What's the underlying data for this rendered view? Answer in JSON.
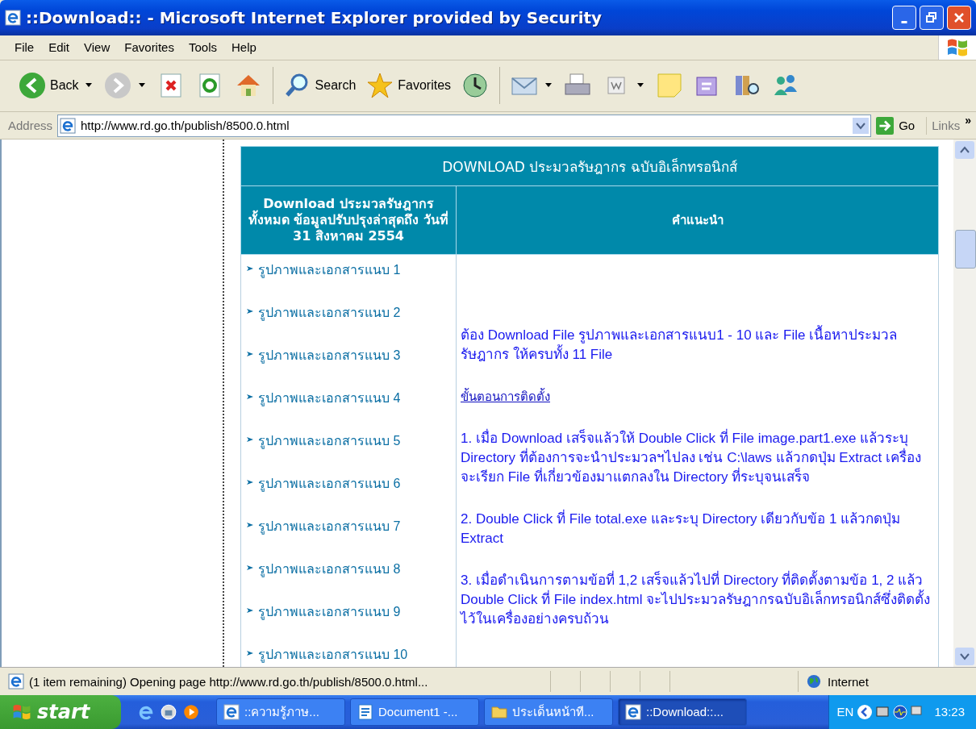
{
  "window": {
    "title": "::Download:: - Microsoft Internet Explorer provided by Security"
  },
  "menu": [
    "File",
    "Edit",
    "View",
    "Favorites",
    "Tools",
    "Help"
  ],
  "toolbar": [
    {
      "kind": "back",
      "label": "Back"
    },
    {
      "kind": "forward"
    },
    {
      "kind": "stop"
    },
    {
      "kind": "refresh"
    },
    {
      "kind": "home"
    },
    {
      "kind": "search",
      "label": "Search"
    },
    {
      "kind": "favorites",
      "label": "Favorites"
    },
    {
      "kind": "history"
    },
    {
      "kind": "mail"
    },
    {
      "kind": "print"
    },
    {
      "kind": "edit"
    },
    {
      "kind": "note"
    },
    {
      "kind": "messenger"
    },
    {
      "kind": "research"
    },
    {
      "kind": "people"
    }
  ],
  "address": {
    "label": "Address",
    "url": "http://www.rd.go.th/publish/8500.0.html",
    "go": "Go",
    "links": "Links",
    "more": "»"
  },
  "table": {
    "title": "DOWNLOAD ประมวลรัษฎากร ฉบับอิเล็กทรอนิกส์",
    "columns": [
      "Download ประมวลรัษฎากร ทั้งหมด ข้อมูลปรับปรุงล่าสุดถึง วันที่ 31 สิงหาคม 2554",
      "คำแนะนำ"
    ],
    "downloads": [
      "รูปภาพและเอกสารแนบ 1",
      "รูปภาพและเอกสารแนบ 2",
      "รูปภาพและเอกสารแนบ 3",
      "รูปภาพและเอกสารแนบ 4",
      "รูปภาพและเอกสารแนบ 5",
      "รูปภาพและเอกสารแนบ 6",
      "รูปภาพและเอกสารแนบ 7",
      "รูปภาพและเอกสารแนบ 8",
      "รูปภาพและเอกสารแนบ 9",
      "รูปภาพและเอกสารแนบ 10"
    ],
    "instructions": [
      {
        "kind": "paragraph",
        "text": "ต้อง Download File รูปภาพและเอกสารแนบ1 - 10 และ File เนื้อหาประมวลรัษฎากร ให้ครบทั้ง 11 File"
      },
      {
        "kind": "heading",
        "text": "ขั้นตอนการติดตั้ง"
      },
      {
        "kind": "paragraph",
        "text": "1. เมื่อ Download เสร็จแล้วให้ Double Click ที่ File image.part1.exe แล้วระบุ Directory ที่ต้องการจะนำประมวลฯไปลง เช่น C:\\laws แล้วกดปุ่ม Extract เครื่องจะเรียก File ที่เกี่ยวข้องมาแตกลงใน Directory ที่ระบุจนเสร็จ"
      },
      {
        "kind": "paragraph",
        "text": "2. Double Click ที่ File total.exe และระบุ Directory เดียวกับข้อ 1 แล้วกดปุ่ม Extract"
      },
      {
        "kind": "paragraph",
        "text": "3. เมื่อดำเนินการตามข้อที่ 1,2 เสร็จแล้วไปที่ Directory ที่ติดตั้งตามข้อ 1, 2 แล้ว Double Click ที่ File index.html จะไปประมวลรัษฎากรฉบับอิเล็กทรอนิกส์ซึ่งติดตั้งไว้ในเครื่องอย่างครบถ้วน"
      }
    ]
  },
  "status_bar": {
    "text": "(1 item remaining) Opening page http://www.rd.go.th/publish/8500.0.html...",
    "zone": "Internet"
  },
  "taskbar": {
    "start": "start",
    "tasks": [
      {
        "label": "::ความรู้ภาษ...",
        "kind": "ie",
        "selected": false
      },
      {
        "label": "Document1 -...",
        "kind": "word",
        "selected": false
      },
      {
        "label": "ประเด็นหน้าที...",
        "kind": "folder",
        "selected": false
      },
      {
        "label": "::Download::...",
        "kind": "ie",
        "selected": true
      }
    ],
    "language": "EN",
    "clock": "13:23"
  }
}
